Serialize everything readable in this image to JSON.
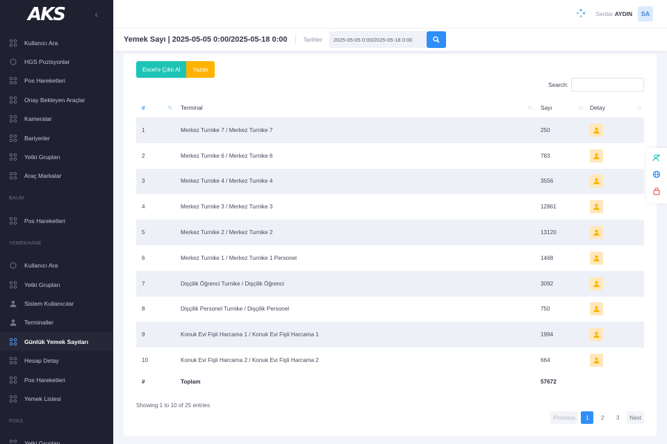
{
  "app": {
    "logo": "AKS"
  },
  "sidebar": {
    "items_top": [
      {
        "label": "Kullanıcı Ara",
        "icon": "grid-icon"
      },
      {
        "label": "HGS Pozisyonlar",
        "icon": "circle-icon"
      },
      {
        "label": "Pos Hareketleri",
        "icon": "grid-icon"
      },
      {
        "label": "Onay Bekleyen Araçlar",
        "icon": "grid-icon"
      },
      {
        "label": "Kameralar",
        "icon": "grid-icon"
      },
      {
        "label": "Bariyerler",
        "icon": "grid-icon"
      },
      {
        "label": "Yetki Grupları",
        "icon": "grid-icon"
      },
      {
        "label": "Araç Markalar",
        "icon": "grid-icon"
      }
    ],
    "section_baum": "BAUM",
    "items_baum": [
      {
        "label": "Pos Hareketleri",
        "icon": "grid-icon"
      }
    ],
    "section_yemekhane": "YEMEKHANE",
    "items_yemekhane": [
      {
        "label": "Kullanıcı Ara",
        "icon": "circle-icon"
      },
      {
        "label": "Yetki Grupları",
        "icon": "grid-icon"
      },
      {
        "label": "Sistem Kullanıcılar",
        "icon": "user-icon"
      },
      {
        "label": "Terminaller",
        "icon": "user-icon"
      },
      {
        "label": "Günlük Yemek Sayıları",
        "icon": "grid-icon",
        "active": true
      },
      {
        "label": "Hesap Detay",
        "icon": "grid-icon"
      },
      {
        "label": "Pos Hareketleri",
        "icon": "grid-icon"
      },
      {
        "label": "Yemek Listesi",
        "icon": "grid-icon"
      }
    ],
    "section_pdks": "PDKS",
    "items_pdks": [
      {
        "label": "Yetki Grupları",
        "icon": "grid-icon"
      }
    ]
  },
  "topbar": {
    "user_first": "Serdar",
    "user_last": "AYDIN",
    "avatar": "SA"
  },
  "subheader": {
    "title": "Yemek Sayı | 2025-05-05 0:00/2025-05-18 0:00",
    "date_label": "Tarihler",
    "date_value": "2025-05-05 0:00/2025-05-18 0:00"
  },
  "toolbar": {
    "excel_label": "Excel'e Çıktı Al",
    "print_label": "Yazdır",
    "search_label": "Search:"
  },
  "table": {
    "headers": [
      "#",
      "Terminal",
      "Sayı",
      "Detay"
    ],
    "rows": [
      {
        "no": "1",
        "terminal": "Merkez Turnike 7 / Merkez Turnike 7",
        "count": "250"
      },
      {
        "no": "2",
        "terminal": "Merkez Turnike 6 / Merkez Turnike 6",
        "count": "783"
      },
      {
        "no": "3",
        "terminal": "Merkez Turnike 4 / Merkez Turnike 4",
        "count": "3556"
      },
      {
        "no": "4",
        "terminal": "Merkez Turnike 3 / Merkez Turnike 3",
        "count": "12861"
      },
      {
        "no": "5",
        "terminal": "Merkez Turnike 2 / Merkez Turnike 2",
        "count": "13120"
      },
      {
        "no": "6",
        "terminal": "Merkez Turnike 1 / Merkez Turnike 1 Personel",
        "count": "1468"
      },
      {
        "no": "7",
        "terminal": "Dişçilik Öğrenci Turnike / Dişçilik Öğrenci",
        "count": "3092"
      },
      {
        "no": "8",
        "terminal": "Dişçilik Personel Turnike / Dişçilik Personel",
        "count": "750"
      },
      {
        "no": "9",
        "terminal": "Konuk Evi Fişli Harcama 1 / Konuk Evi Fişli Harcama 1",
        "count": "1994"
      },
      {
        "no": "10",
        "terminal": "Konuk Evi Fişli Harcama 2 / Konuk Evi Fişli Harcama 2",
        "count": "664"
      }
    ],
    "footer": {
      "no": "#",
      "label": "Toplam",
      "total": "57672"
    }
  },
  "pagination": {
    "info": "Showing 1 to 10 of 25 entries",
    "previous": "Previous",
    "pages": [
      "1",
      "2",
      "3"
    ],
    "next": "Next"
  },
  "colors": {
    "accent": "#2f8ef7",
    "excel": "#1dc4b5",
    "print": "#ffb200",
    "sidebar": "#1f2131"
  }
}
